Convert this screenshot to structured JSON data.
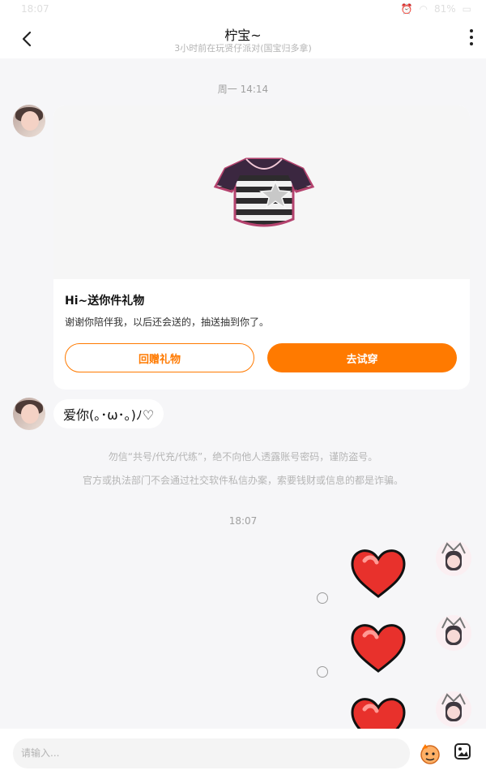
{
  "status_bar": {
    "time": "18:07",
    "battery": "81%"
  },
  "header": {
    "title": "柠宝~",
    "subtitle": "3小时前在玩贤仔派对(国宝归多拿)"
  },
  "messages": [
    {
      "time": "周一 14:14"
    },
    {
      "gift_card": {
        "title": "Hi~送你件礼物",
        "description": "谢谢你陪伴我，以后还会送的，抽送抽到你了。",
        "button_return": "回赠礼物",
        "button_try": "去试穿"
      }
    },
    {
      "text": "爱你(｡･ω･｡)ﾉ♡"
    },
    {
      "notices": [
        "勿信“共号/代充/代练”，绝不向他人透露账号密码，谨防盗号。",
        "官方或执法部门不会通过社交软件私信办案，索要钱财或信息的都是诈骗。"
      ]
    },
    {
      "time": "18:07"
    }
  ],
  "input": {
    "placeholder": "请输入..."
  },
  "icons": {
    "back": "chevron-left-icon",
    "more": "more-vertical-icon",
    "emoji": "emoji-icon",
    "image": "image-icon",
    "heart": "heart-icon"
  },
  "colors": {
    "accent": "#ff7a00",
    "heart": "#e8312c",
    "background": "#f6f6f8"
  }
}
